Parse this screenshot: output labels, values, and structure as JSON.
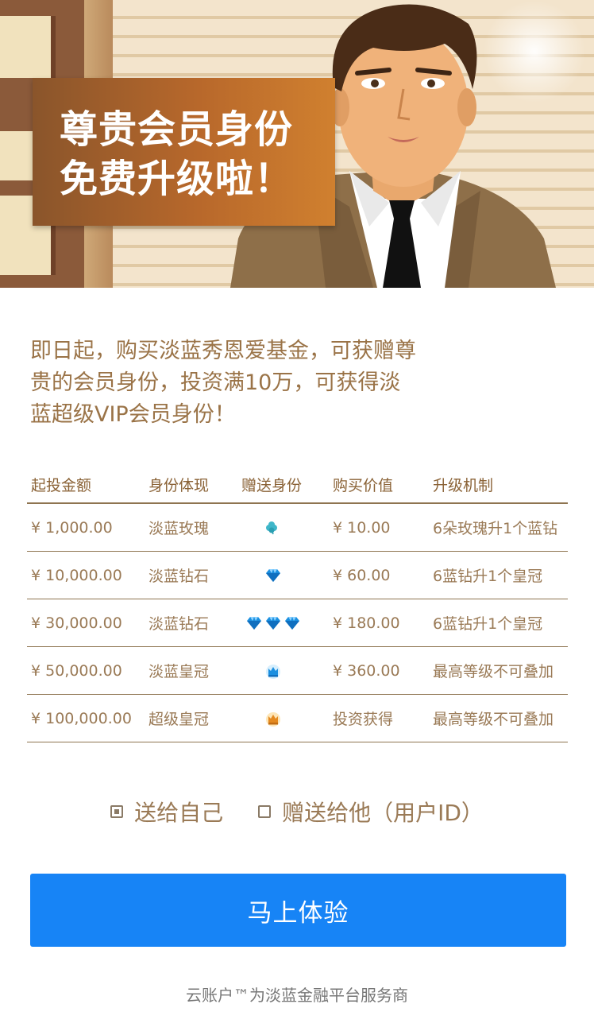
{
  "banner": {
    "headline_line1": "尊贵会员身份",
    "headline_line2": "免费升级啦！"
  },
  "intro": {
    "text": "即日起，购买淡蓝秀恩爱基金，可获赠尊贵的会员身份，投资满10万，可获得淡蓝超级VIP会员身份！"
  },
  "table": {
    "headers": [
      "起投金额",
      "身份体现",
      "赠送身份",
      "购买价值",
      "升级机制"
    ],
    "rows": [
      {
        "amount": "¥ 1,000.00",
        "identity": "淡蓝玫瑰",
        "gift_icon": "clover-icon",
        "gift_count": 1,
        "value": "¥ 10.00",
        "upgrade": "6朵玫瑰升1个蓝钻"
      },
      {
        "amount": "¥ 10,000.00",
        "identity": "淡蓝钻石",
        "gift_icon": "diamond-icon",
        "gift_count": 1,
        "value": "¥ 60.00",
        "upgrade": "6蓝钻升1个皇冠"
      },
      {
        "amount": "¥ 30,000.00",
        "identity": "淡蓝钻石",
        "gift_icon": "diamond-icon",
        "gift_count": 3,
        "value": "¥ 180.00",
        "upgrade": "6蓝钻升1个皇冠"
      },
      {
        "amount": "¥ 50,000.00",
        "identity": "淡蓝皇冠",
        "gift_icon": "blue-crown-icon",
        "gift_count": 1,
        "value": "¥ 360.00",
        "upgrade": "最高等级不可叠加"
      },
      {
        "amount": "¥ 100,000.00",
        "identity": "超级皇冠",
        "gift_icon": "gold-crown-icon",
        "gift_count": 1,
        "value": "投资获得",
        "upgrade": "最高等级不可叠加"
      }
    ]
  },
  "options": {
    "self_label": "送给自己",
    "self_checked": true,
    "other_label": "赠送给他（用户ID）",
    "other_checked": false
  },
  "cta": {
    "label": "马上体验"
  },
  "footer": {
    "text": "云账户™为淡蓝金融平台服务商"
  },
  "colors": {
    "accent": "#1784f6",
    "text_brown": "#9a7347",
    "headline_bg": "#b8682b"
  }
}
